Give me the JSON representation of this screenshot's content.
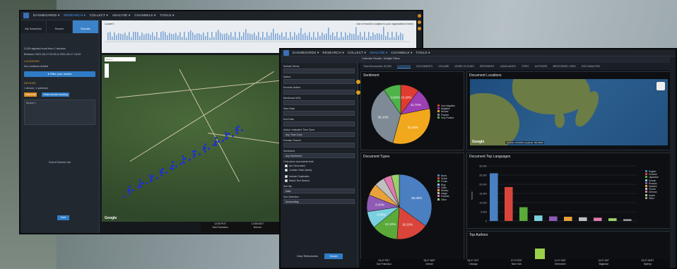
{
  "left_app": {
    "nav": [
      "DASHBOARDS ▾",
      "RESEARCH ▾",
      "COLLECT ▾",
      "ANALYZE ▾",
      "CHANNELS ▾",
      "TOOLS ▾"
    ],
    "active_nav_index": 1,
    "tabs": [
      "My Searches",
      "Search",
      "Results"
    ],
    "results_count": "3,245 signals found from 1 devices",
    "range": "Between 2021-06-17 00:00 & 2021-06-17 15:00",
    "locations_head": "LOCATIONS",
    "locations_text": "No Locations Added",
    "filter_button": "Filter your results",
    "devices_head": "DEVICES",
    "devices_count": "1 device, 1 selected",
    "device_btn_select": "Select All",
    "device_btn_tracking": "Select device tracking",
    "device_name": "Device 1",
    "end_of_list": "End of Device List",
    "save_button": "Save",
    "timeline_label": "Locate it",
    "timeline_note": "Use of results is subject to your organization's terms",
    "map_search_placeholder": "Search",
    "map_latlon": "Latitude: 00.0000 Longitude: -00.0000",
    "google": "Google",
    "timezones": [
      {
        "time": "12:55 PDT",
        "place": "San Francisco"
      },
      {
        "time": "13:55 MDT",
        "place": "Denver"
      },
      {
        "time": "14:55 CDT",
        "place": "Chicago"
      },
      {
        "time": "15:55 EDT",
        "place": "New York"
      },
      {
        "time": "19:55 GMT",
        "place": "Greenwich"
      },
      {
        "time": "22:55 AST",
        "place": "Baghdad"
      }
    ]
  },
  "right_app": {
    "nav": [
      "DASHBOARDS ▾",
      "RESEARCH ▾",
      "COLLECT ▾",
      "ANALYZE ▾",
      "CHANNELS ▾",
      "TOOLS ▾"
    ],
    "active_nav_index": 3,
    "breadcrumb": "Collection Results › Multiple Filters",
    "sub_tabs": [
      "Total Documents: 00,000",
      "OVERVIEW",
      "DOCUMENTS",
      "VOLUME",
      "WORD CLOUDS",
      "SENTIMENT",
      "LANGUAGES",
      "TOPIC",
      "AUTHORS",
      "MENTIONED USES",
      "GEO ANALYSIS"
    ],
    "active_sub_tab": 1,
    "filters": [
      {
        "label": "Include Terms",
        "type": "input",
        "dot": false
      },
      {
        "label": "Author",
        "type": "input",
        "dot": true
      },
      {
        "label": "Exclude Author",
        "type": "input",
        "dot": true
      },
      {
        "label": "Mentioned URL",
        "type": "input",
        "dot": false
      },
      {
        "label": "Start Date",
        "type": "input",
        "dot": false
      },
      {
        "label": "End Date",
        "type": "select",
        "value": "",
        "dot": false
      },
      {
        "label": "Author Indicated Time Zone",
        "type": "select",
        "value": "Any Time Zone",
        "dot": false
      },
      {
        "label": "Domain Search",
        "type": "input",
        "dot": false
      },
      {
        "label": "Sentiment",
        "type": "select",
        "value": "Any Sentiment",
        "dot": false
      }
    ],
    "only_show_label": "Only show documents that:",
    "checkboxes_a": [
      "Are Geocoded",
      "Contain Video (beta)"
    ],
    "checkboxes_b": [
      "Include Duplicates",
      "Match Text Search"
    ],
    "sort_by_label": "Sort By",
    "sort_by_value": "Date",
    "sort_dir_label": "Sort Direction",
    "sort_dir_value": "Descending",
    "clear_button": "Clear Refinements",
    "search_button": "Search",
    "panel_sentiment": "Sentiment",
    "panel_locations": "Document Locations",
    "panel_types": "Document Types",
    "panel_languages": "Document Top Languages",
    "panel_authors": "Top Authors",
    "map_latlon": "Latitude: 00.0000 Longitude: 000.0000",
    "google": "Google",
    "timezones": [
      {
        "time": "04:27 PDT",
        "place": "San Francisco"
      },
      {
        "time": "05:27 MDT",
        "place": "Denver"
      },
      {
        "time": "06:27 CDT",
        "place": "Chicago"
      },
      {
        "time": "07:27 EDT",
        "place": "New York"
      },
      {
        "time": "11:27 GMT",
        "place": "Greenwich"
      },
      {
        "time": "14:27 AST",
        "place": "Baghdad"
      },
      {
        "time": "20:27 AEST",
        "place": "Sydney"
      }
    ]
  },
  "chart_data": [
    {
      "type": "pie",
      "title": "Sentiment",
      "categories": [
        "Very Negative",
        "Negative",
        "Neutral",
        "Positive",
        "Very Positive"
      ],
      "values": [
        10.2,
        11.7,
        32.4,
        36.1,
        9.6
      ],
      "colors": [
        "#e03b2f",
        "#9b3fb3",
        "#f2a81d",
        "#7e8a96",
        "#4db34a"
      ]
    },
    {
      "type": "pie",
      "title": "Document Types",
      "categories": [
        "News",
        "Social",
        "Forum",
        "Blog",
        "Video",
        "Review",
        "Image",
        "Podcast",
        "Other"
      ],
      "values": [
        35.0,
        16.1,
        13.1,
        8.4,
        8.4,
        6.0,
        5.0,
        4.0,
        4.0
      ],
      "colors": [
        "#4a7fc1",
        "#d9453a",
        "#5aaa3a",
        "#7bd0e0",
        "#8f5bb5",
        "#e8a23a",
        "#c0c0c0",
        "#e07ab0",
        "#9ad06a"
      ]
    },
    {
      "type": "bar",
      "title": "Document Top Languages",
      "categories": [
        "English",
        "Chinese",
        "Japanese",
        "Korean",
        "Russian",
        "Spanish",
        "French",
        "German",
        "Arabic",
        "Other"
      ],
      "values": [
        26000,
        18500,
        7500,
        3000,
        2500,
        2300,
        2000,
        1800,
        1500,
        1000
      ],
      "colors": [
        "#4a7fc1",
        "#d9453a",
        "#5aaa3a",
        "#7bd0e0",
        "#8f5bb5",
        "#e8a23a",
        "#c0c0c0",
        "#e07ab0",
        "#9ad06a",
        "#999999"
      ],
      "ylim": [
        0,
        30000
      ],
      "ylabel": "Volume"
    }
  ]
}
